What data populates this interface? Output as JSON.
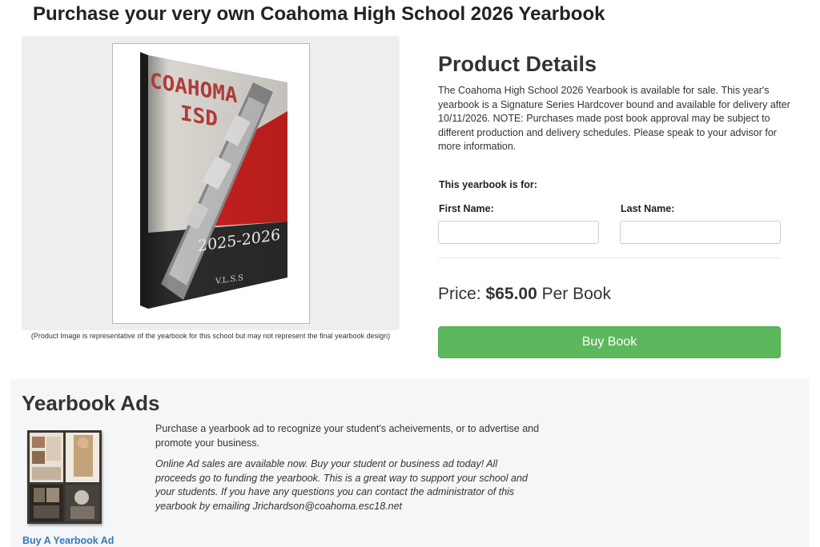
{
  "page": {
    "title": "Purchase your very own Coahoma High School 2026 Yearbook"
  },
  "product_image": {
    "cover_title_line1": "COAHOMA",
    "cover_title_line2": "ISD",
    "cover_years": "2025-2026",
    "cover_footer": "V.L.S.S",
    "caption": "(Product Image is representative of the yearbook for this school but may not represent the final yearbook design)"
  },
  "details": {
    "title": "Product Details",
    "description": "The Coahoma High School 2026 Yearbook is available for sale. This year's yearbook is a Signature Series Hardcover bound and available for delivery after 10/11/2026. NOTE: Purchases made post book approval may be subject to different production and delivery schedules. Please speak to your advisor for more information.",
    "for_label": "This yearbook is for:",
    "first_name_label": "First Name:",
    "first_name_value": "",
    "last_name_label": "Last Name:",
    "last_name_value": "",
    "price_prefix": "Price:",
    "price_amount": "$65.00",
    "price_suffix": "Per Book",
    "buy_label": "Buy Book"
  },
  "ads": {
    "title": "Yearbook Ads",
    "description": "Purchase a yearbook ad to recognize your student's acheivements, or to advertise and promote your business.",
    "note": "Online Ad sales are available now. Buy your student or business ad today! All proceeds go to funding the yearbook. This is a great way to support your school and your students. If you have any questions you can contact the administrator of this yearbook by emailing Jrichardson@coahoma.esc18.net",
    "link_label": "Buy A Yearbook Ad"
  },
  "colors": {
    "buy_button": "#5cb85c",
    "link": "#337ab7",
    "cover_red": "#c8211e",
    "ads_panel_bg": "#f5f6f8"
  },
  "icons": {
    "product": "yearbook-cover-image",
    "ad_sample": "yearbook-ad-thumbnail"
  }
}
